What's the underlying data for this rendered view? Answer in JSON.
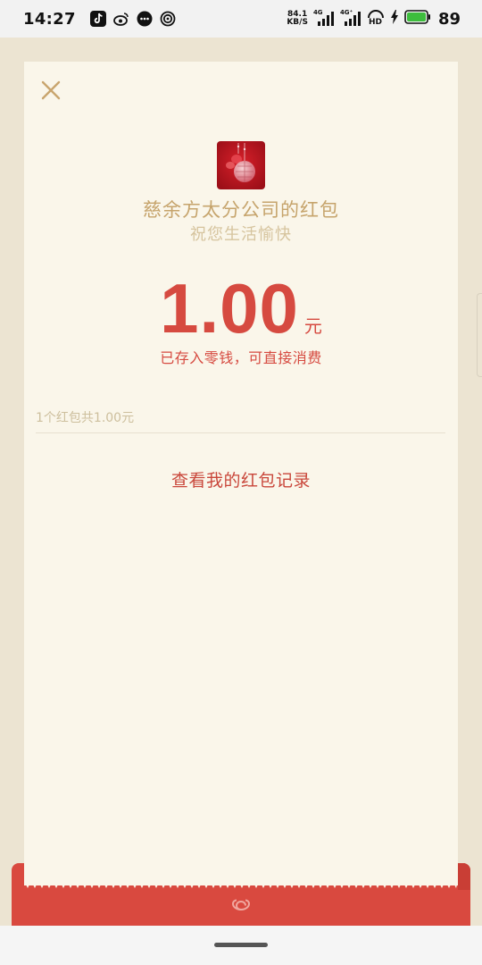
{
  "status_bar": {
    "time": "14:27",
    "left_icons": [
      "tiktok-icon",
      "weibo-icon",
      "message-icon",
      "hotspot-icon"
    ],
    "net_speed_value": "84.1",
    "net_speed_unit": "KB/S",
    "signal_labels": [
      "4G",
      "4G⁺"
    ],
    "hd_label": "HD",
    "battery_level": "89",
    "battery_color": "#3dbd3d"
  },
  "card": {
    "sender": "慈余方太分公司的红包",
    "wish": "祝您生活愉快",
    "amount": "1.00",
    "unit": "元",
    "deposit_note": "已存入零钱，可直接消费",
    "summary": "1个红包共1.00元",
    "records_link": "查看我的红包记录"
  },
  "colors": {
    "accent_red": "#d64a40",
    "gold": "#c6a46c",
    "card_bg": "#faf6ea",
    "page_bg": "#ece4d2"
  }
}
